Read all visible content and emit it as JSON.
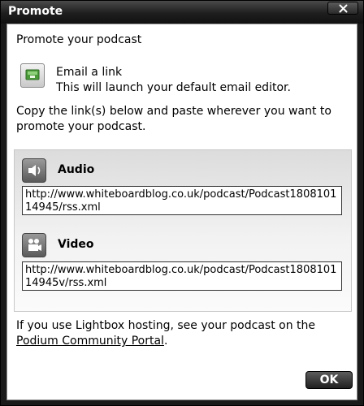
{
  "window": {
    "title": "Promote"
  },
  "main": {
    "heading": "Promote your podcast",
    "email": {
      "title": "Email a link",
      "description": "This will launch your default email editor."
    },
    "copy_instructions": "Copy the link(s) below and paste wherever you want to promote your podcast.",
    "audio": {
      "label": "Audio",
      "url": "http://www.whiteboardblog.co.uk/podcast/Podcast180810114945/rss.xml"
    },
    "video": {
      "label": "Video",
      "url": "http://www.whiteboardblog.co.uk/podcast/Podcast180810114945v/rss.xml"
    },
    "footer": {
      "text_before": "If you use Lightbox hosting, see your podcast on the ",
      "link": "Podium Community Portal",
      "text_after": "."
    }
  },
  "buttons": {
    "ok": "OK"
  },
  "icons": {
    "close": "close-icon",
    "email": "email-icon",
    "audio": "speaker-icon",
    "video": "video-camera-icon"
  }
}
